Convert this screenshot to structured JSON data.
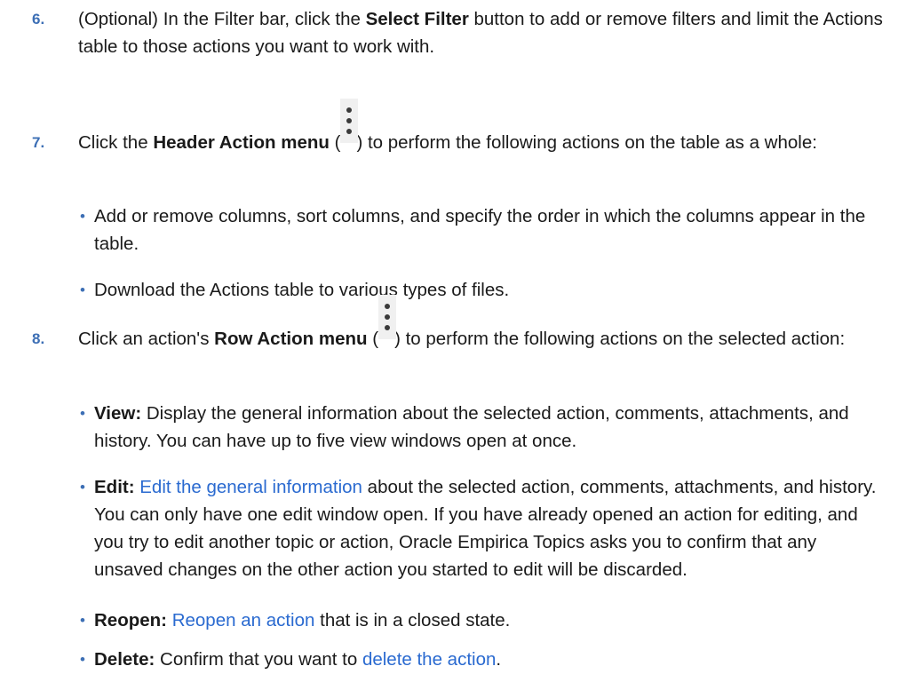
{
  "steps": [
    {
      "number": "6.",
      "prefix": "(Optional) In the Filter bar, click the ",
      "bold": "Select Filter",
      "suffix": " button to add or remove filters and limit the Actions table to those actions you want to work with."
    },
    {
      "number": "7.",
      "prefix": "Click the ",
      "bold": "Header Action menu",
      "open_paren": " (",
      "icon": "kebab-menu-icon",
      "after_icon": ") to perform the following actions on the table as a whole:",
      "bullets": [
        "Add or remove columns, sort columns, and specify the order in which the columns appear in the table.",
        "Download the Actions table to various types of files."
      ]
    },
    {
      "number": "8.",
      "prefix": "Click an action's ",
      "bold": "Row Action menu",
      "open_paren": " (",
      "icon": "kebab-menu-icon",
      "after_icon": ") to perform the following actions on the selected action:",
      "bullets": [
        {
          "label": "View:",
          "text": " Display the general information about the selected action, comments, attachments, and history. You can have up to five view windows open at once."
        },
        {
          "label": "Edit:",
          "before_link": " ",
          "link": "Edit the general information",
          "text": " about the selected action, comments, attachments, and history. You can only have one edit window open. If you have already opened an action for editing, and you try to edit another topic or action, Oracle Empirica Topics asks you to confirm that any unsaved changes on the other action you started to edit will be discarded."
        },
        {
          "label": "Reopen:",
          "before_link": " ",
          "link": "Reopen an action",
          "text": " that is in a closed state."
        },
        {
          "label": "Delete:",
          "before_link": " Confirm that you want to ",
          "link": "delete the action",
          "text": "."
        }
      ]
    }
  ],
  "bullet_char": "•",
  "colors": {
    "step_number": "#3d6fb5",
    "bullet": "#3d6fb5",
    "link": "#2a6ad0",
    "text": "#1a1a1a",
    "icon_bg": "#f0f0f0",
    "icon_dot": "#3a3a3a"
  }
}
